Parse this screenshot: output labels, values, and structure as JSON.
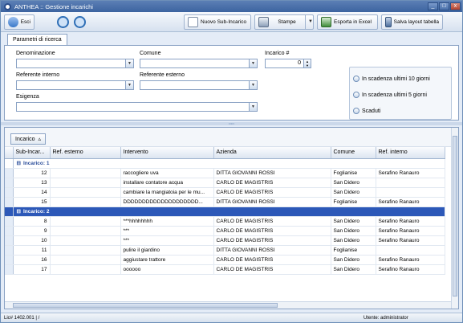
{
  "window": {
    "title": "ANTHEA :: Gestione incarichi",
    "buttons": [
      "_",
      "□",
      "x"
    ]
  },
  "toolbar": {
    "esci": "Esci",
    "nuovo": "Nuovo Sub-Incarico",
    "stampe": "Stampe",
    "esporta": "Esporta in Excel",
    "salva_layout": "Salva layout tabella"
  },
  "search": {
    "tab": "Parametri di ricerca",
    "denominazione": "Denominazione",
    "comune": "Comune",
    "incarico_label": "Incarico #",
    "incarico_value": "0",
    "referente_interno": "Referente interno",
    "referente_esterno": "Referente esterno",
    "esigenza": "Esigenza",
    "radio": [
      "In scadenza ultimi 10 giorni",
      "In scadenza ultimi 5 giorni",
      "Scaduti"
    ]
  },
  "grid": {
    "group_chip": "Incarico",
    "group_chip_sort": "▵",
    "columns": [
      "Sub-Incar...",
      "Ref. esterno",
      "Intervento",
      "Azienda",
      "Comune",
      "Ref. interno"
    ],
    "groups": [
      {
        "label": "Incarico: 1",
        "expander": "⊟",
        "rows": [
          [
            "12",
            "",
            "raccogliere uva",
            "DITTA GIOVANNI ROSSI",
            "Foglianise",
            "Serafino Ranauro"
          ],
          [
            "13",
            "",
            "installare contatore acqua",
            "CARLO DE MAGISTRIS",
            "San Didero",
            ""
          ],
          [
            "14",
            "",
            "cambiare la mangiatoia per le mu...",
            "CARLO DE MAGISTRIS",
            "San Didero",
            ""
          ],
          [
            "15",
            "",
            "DDDDDDDDDDDDDDDDDDDD...",
            "DITTA GIOVANNI ROSSI",
            "Foglianise",
            "Serafino Ranauro"
          ]
        ]
      },
      {
        "label": "Incarico: 2",
        "expander": "⊟",
        "active": true,
        "rows": [
          [
            "8",
            "",
            "***hhhhhhhh",
            "CARLO DE MAGISTRIS",
            "San Didero",
            "Serafino Ranauro"
          ],
          [
            "9",
            "",
            "***",
            "CARLO DE MAGISTRIS",
            "San Didero",
            "Serafino Ranauro"
          ],
          [
            "10",
            "",
            "***",
            "CARLO DE MAGISTRIS",
            "San Didero",
            "Serafino Ranauro"
          ],
          [
            "11",
            "",
            "pulire il giardino",
            "DITTA GIOVANNI ROSSI",
            "Foglianise",
            ""
          ],
          [
            "16",
            "",
            "aggiustare trattore",
            "CARLO DE MAGISTRIS",
            "San Didero",
            "Serafino Ranauro"
          ],
          [
            "17",
            "",
            "oooooo",
            "CARLO DE MAGISTRIS",
            "San Didero",
            "Serafino Ranauro"
          ]
        ]
      }
    ]
  },
  "status": {
    "left": "Lic# 1402.001 | /",
    "user": "Utente: administrator"
  }
}
